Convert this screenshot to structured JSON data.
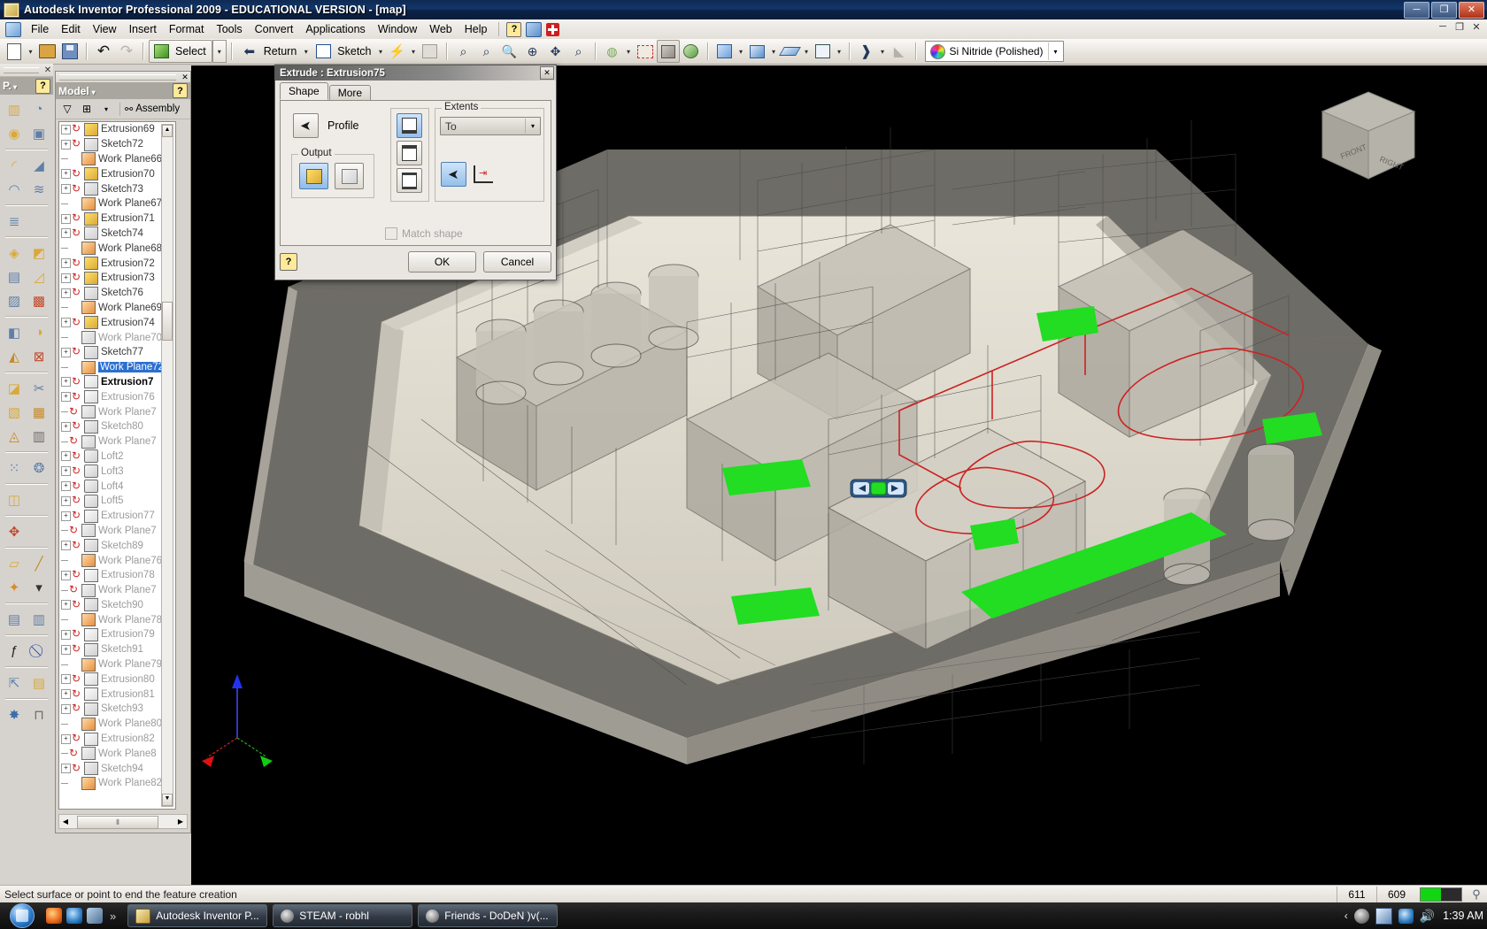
{
  "window": {
    "title": "Autodesk Inventor Professional 2009 - EDUCATIONAL VERSION - [map]",
    "minimize": "─",
    "restore": "❐",
    "close": "✕",
    "inner_minimize": "─",
    "inner_restore": "❐",
    "inner_close": "✕"
  },
  "menubar": {
    "items": [
      "File",
      "Edit",
      "View",
      "Insert",
      "Format",
      "Tools",
      "Convert",
      "Applications",
      "Window",
      "Web",
      "Help"
    ],
    "help_icon": "?",
    "icons": [
      "app-icon",
      "help-question-icon",
      "blue-help-icon",
      "red-plus-icon"
    ]
  },
  "toolbar": {
    "new_label": "new-file",
    "open_label": "open-file",
    "save_label": "save-file",
    "undo_label": "undo",
    "redo_label": "redo",
    "select_label": "Select",
    "return_label": "Return",
    "sketch_label": "Sketch",
    "update_label": "update",
    "material": {
      "value": "Si Nitride (Polished)",
      "swatch": "color-wheel-icon"
    },
    "zoom_icons": [
      "zoom-window-icon",
      "zoom-all-icon",
      "zoom-in-icon",
      "pan-icon",
      "zoom-selected-icon",
      "orbit-icon",
      "look-at-icon",
      "display-shaded-icon",
      "shadow-icon",
      "camera-icon",
      "visual-style-icon",
      "shaded-cube-icon",
      "wireframe-cube-icon",
      "plane-icon",
      "quad-view-icon",
      "perspective-icon",
      "ground-shadow-icon"
    ]
  },
  "panel_bar": {
    "title": "P.",
    "help": "?",
    "close": "✕",
    "icon_groups": [
      [
        "extrude-icon",
        "revolve-icon"
      ],
      [
        "hole-icon",
        "shell-icon"
      ],
      [
        "fillet-icon",
        "chamfer-icon"
      ],
      [
        "sweep-icon",
        "coil-icon"
      ],
      [
        "thread-icon"
      ],
      [
        "loft-icon",
        "rib-icon"
      ],
      [
        "emboss-icon",
        "draft-icon"
      ],
      [
        "decal-icon",
        "derive-icon"
      ],
      [
        "split-icon",
        "bend-part-icon"
      ],
      [
        "face-draft-icon",
        "delete-face-icon"
      ],
      [
        "thicken-icon",
        "stitch-icon"
      ],
      [
        "replace-face-icon",
        "patch-icon"
      ],
      [
        "sculpt-icon",
        "grill-icon"
      ],
      [
        "rectangular-pattern-icon",
        "circular-pattern-icon"
      ],
      [
        "mirror-icon"
      ],
      [
        "move-face-icon"
      ],
      [
        "work-plane-icon",
        "work-axis-icon"
      ],
      [
        "work-point-icon",
        "work-point-dropdown-icon"
      ],
      [
        "promote-icon",
        "demote-icon"
      ],
      [
        "parameters-icon",
        "suppress-icon"
      ],
      [
        "create-icon",
        "insert-icon"
      ],
      [
        "bolted-connection-icon",
        "shaft-icon"
      ]
    ]
  },
  "browser": {
    "title": "Model",
    "dropdown": "▾",
    "help": "?",
    "toolbar_icons": [
      "filter-icon",
      "tree-view-icon",
      "tree-dropdown-icon",
      "assembly-icon"
    ],
    "assembly_label": "Assembly",
    "scroll_up": "▲",
    "scroll_down": "▼",
    "h_left": "◀",
    "h_right": "▶",
    "nodes": [
      {
        "label": "Extrusion69",
        "type": "extrusion",
        "expand": true,
        "ref": true,
        "state": "normal"
      },
      {
        "label": "Sketch72",
        "type": "sketch",
        "expand": true,
        "ref": true,
        "state": "normal"
      },
      {
        "label": "Work Plane66",
        "type": "workplane",
        "expand": false,
        "ref": false,
        "state": "normal"
      },
      {
        "label": "Extrusion70",
        "type": "extrusion",
        "expand": true,
        "ref": true,
        "state": "normal"
      },
      {
        "label": "Sketch73",
        "type": "sketch",
        "expand": true,
        "ref": true,
        "state": "normal"
      },
      {
        "label": "Work Plane67",
        "type": "workplane",
        "expand": false,
        "ref": false,
        "state": "normal"
      },
      {
        "label": "Extrusion71",
        "type": "extrusion",
        "expand": true,
        "ref": true,
        "state": "normal"
      },
      {
        "label": "Sketch74",
        "type": "sketch",
        "expand": true,
        "ref": true,
        "state": "normal"
      },
      {
        "label": "Work Plane68",
        "type": "workplane",
        "expand": false,
        "ref": false,
        "state": "normal"
      },
      {
        "label": "Extrusion72",
        "type": "extrusion",
        "expand": true,
        "ref": true,
        "state": "normal"
      },
      {
        "label": "Extrusion73",
        "type": "extrusion",
        "expand": true,
        "ref": true,
        "state": "normal"
      },
      {
        "label": "Sketch76",
        "type": "sketch",
        "expand": true,
        "ref": true,
        "state": "normal"
      },
      {
        "label": "Work Plane69",
        "type": "workplane",
        "expand": false,
        "ref": false,
        "state": "normal"
      },
      {
        "label": "Extrusion74",
        "type": "extrusion",
        "expand": true,
        "ref": true,
        "state": "normal"
      },
      {
        "label": "Work Plane70",
        "type": "workplane-gray",
        "expand": false,
        "ref": false,
        "state": "gray"
      },
      {
        "label": "Sketch77",
        "type": "sketch",
        "expand": true,
        "ref": true,
        "state": "normal"
      },
      {
        "label": "Work Plane72",
        "type": "workplane",
        "expand": false,
        "ref": false,
        "state": "selected"
      },
      {
        "label": "Extrusion7",
        "type": "extrusion-gray",
        "expand": true,
        "ref": true,
        "state": "bold"
      },
      {
        "label": "Extrusion76",
        "type": "extrusion-gray",
        "expand": true,
        "ref": true,
        "state": "gray"
      },
      {
        "label": "Work Plane7",
        "type": "workplane-gray",
        "expand": false,
        "ref": true,
        "state": "gray"
      },
      {
        "label": "Sketch80",
        "type": "sketch",
        "expand": true,
        "ref": true,
        "state": "gray"
      },
      {
        "label": "Work Plane7",
        "type": "workplane-gray",
        "expand": false,
        "ref": true,
        "state": "gray"
      },
      {
        "label": "Loft2",
        "type": "loft",
        "expand": true,
        "ref": true,
        "state": "gray"
      },
      {
        "label": "Loft3",
        "type": "loft",
        "expand": true,
        "ref": true,
        "state": "gray"
      },
      {
        "label": "Loft4",
        "type": "loft",
        "expand": true,
        "ref": true,
        "state": "gray"
      },
      {
        "label": "Loft5",
        "type": "loft",
        "expand": true,
        "ref": true,
        "state": "gray"
      },
      {
        "label": "Extrusion77",
        "type": "extrusion-gray",
        "expand": true,
        "ref": true,
        "state": "gray"
      },
      {
        "label": "Work Plane7",
        "type": "workplane-gray",
        "expand": false,
        "ref": true,
        "state": "gray"
      },
      {
        "label": "Sketch89",
        "type": "sketch",
        "expand": true,
        "ref": true,
        "state": "gray"
      },
      {
        "label": "Work Plane76",
        "type": "workplane",
        "expand": false,
        "ref": false,
        "state": "gray"
      },
      {
        "label": "Extrusion78",
        "type": "extrusion-gray",
        "expand": true,
        "ref": true,
        "state": "gray"
      },
      {
        "label": "Work Plane7",
        "type": "workplane-gray",
        "expand": false,
        "ref": true,
        "state": "gray"
      },
      {
        "label": "Sketch90",
        "type": "sketch",
        "expand": true,
        "ref": true,
        "state": "gray"
      },
      {
        "label": "Work Plane78",
        "type": "workplane",
        "expand": false,
        "ref": false,
        "state": "gray"
      },
      {
        "label": "Extrusion79",
        "type": "extrusion-gray",
        "expand": true,
        "ref": true,
        "state": "gray"
      },
      {
        "label": "Sketch91",
        "type": "sketch",
        "expand": true,
        "ref": true,
        "state": "gray"
      },
      {
        "label": "Work Plane79",
        "type": "workplane",
        "expand": false,
        "ref": false,
        "state": "gray"
      },
      {
        "label": "Extrusion80",
        "type": "extrusion-gray",
        "expand": true,
        "ref": true,
        "state": "gray"
      },
      {
        "label": "Extrusion81",
        "type": "extrusion-gray",
        "expand": true,
        "ref": true,
        "state": "gray"
      },
      {
        "label": "Sketch93",
        "type": "sketch",
        "expand": true,
        "ref": true,
        "state": "gray"
      },
      {
        "label": "Work Plane80",
        "type": "workplane",
        "expand": false,
        "ref": false,
        "state": "gray"
      },
      {
        "label": "Extrusion82",
        "type": "extrusion-gray",
        "expand": true,
        "ref": true,
        "state": "gray"
      },
      {
        "label": "Work Plane8",
        "type": "workplane-gray",
        "expand": false,
        "ref": true,
        "state": "gray"
      },
      {
        "label": "Sketch94",
        "type": "sketch",
        "expand": true,
        "ref": true,
        "state": "gray"
      },
      {
        "label": "Work Plane82",
        "type": "workplane",
        "expand": false,
        "ref": false,
        "state": "gray"
      }
    ]
  },
  "dialog": {
    "title": "Extrude : Extrusion75",
    "close": "✕",
    "tabs": [
      {
        "label": "Shape",
        "active": true
      },
      {
        "label": "More",
        "active": false
      }
    ],
    "profile_label": "Profile",
    "profile_button": "select-profile-cursor-icon",
    "output_label": "Output",
    "output_solid": "solid-output-icon",
    "output_surface": "surface-output-icon",
    "direction_buttons": [
      "direction-1-icon",
      "direction-2-icon",
      "direction-symmetric-icon"
    ],
    "extents_label": "Extents",
    "extents_value": "To",
    "extents_dropdown": "▾",
    "terminator_select": "select-terminator-cursor-icon",
    "extend_faces": "extend-faces-icon",
    "match_shape_label": "Match shape",
    "match_shape_checked": false,
    "help": "?",
    "ok": "OK",
    "cancel": "Cancel"
  },
  "viewport": {
    "viewcube_label": "view-cube",
    "axis_indicator": "origin-axis-triad",
    "mini_toolbar": "direction-mini-toolbar"
  },
  "statusbar": {
    "message": "Select surface or point to end the feature creation",
    "value1": "611",
    "value2": "609",
    "progress_icon": "memory-gauge",
    "sat_icon": "network-icon"
  },
  "taskbar": {
    "start": "start-orb",
    "quicklaunch": [
      "firefox-icon",
      "internet-explorer-icon",
      "show-desktop-icon"
    ],
    "more": "»",
    "tasks": [
      {
        "label": "Autodesk Inventor P...",
        "icon": "inventor-icon",
        "active": true
      },
      {
        "label": "STEAM - robhl",
        "icon": "steam-icon",
        "active": false
      },
      {
        "label": "Friends - DoDeN )v(...",
        "icon": "steam-icon",
        "active": false
      }
    ],
    "tray": [
      "chevron-left-icon",
      "steam-tray-icon",
      "window-tray-icon",
      "network-tray-icon",
      "volume-tray-icon"
    ],
    "clock": "1:39 AM"
  },
  "colors": {
    "title_bar": "#12366b",
    "accent_blue": "#2b6fd1",
    "highlight_green": "#22dd22",
    "sketch_red": "#cc2222",
    "panel_bg": "#d6d3ce"
  }
}
